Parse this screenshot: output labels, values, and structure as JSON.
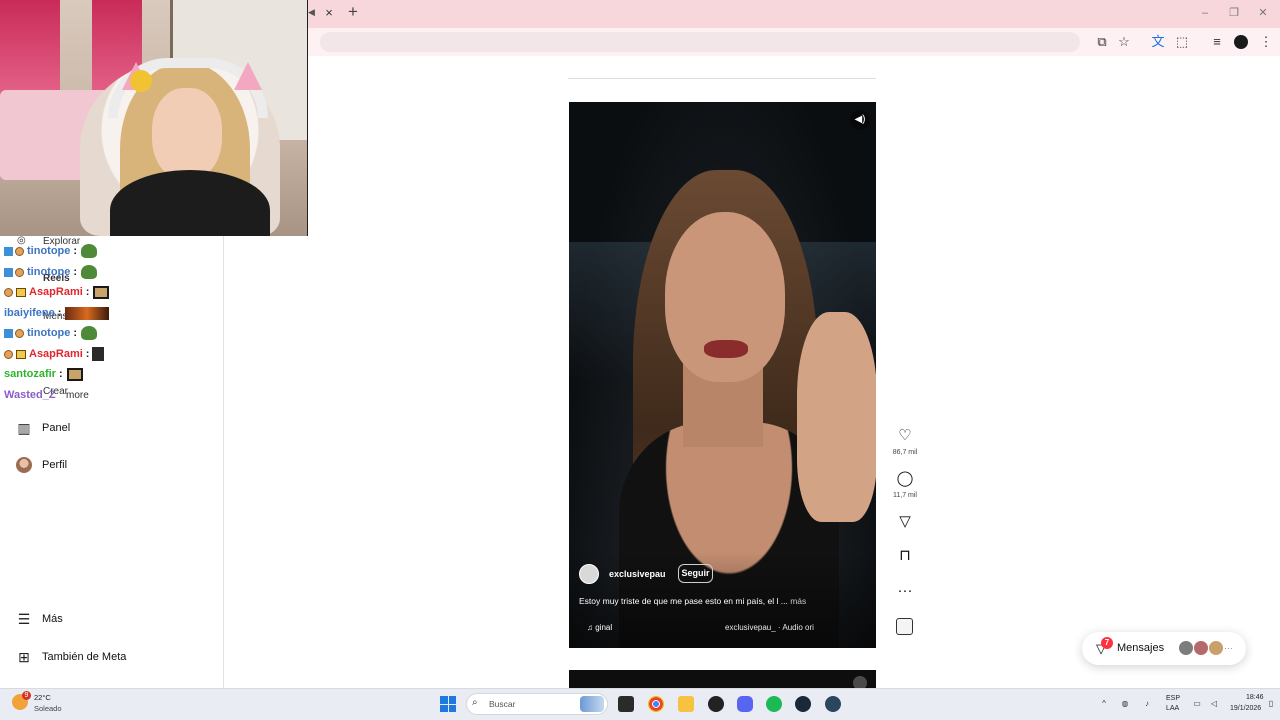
{
  "browser": {
    "tab_close": "×",
    "new_tab": "+"
  },
  "sidebar": {
    "items": [
      {
        "label": "Panel",
        "icon": "chart-icon"
      },
      {
        "label": "Perfil",
        "icon": "avatar"
      },
      {
        "label": "Más",
        "icon": "menu-icon"
      },
      {
        "label": "También de Meta",
        "icon": "grid-icon"
      }
    ],
    "ghost_items": [
      "Explorar",
      "Reels",
      "Mensa",
      "Crear",
      "more"
    ]
  },
  "chat": {
    "messages": [
      {
        "user": "tinotope",
        "sep": ":",
        "color": "#3d74c2",
        "emote": "pepe"
      },
      {
        "user": "tinotope",
        "sep": ":",
        "color": "#3d74c2",
        "emote": "pepe"
      },
      {
        "user": "AsapRami",
        "sep": ":",
        "color": "#e0262e",
        "emote": "glasses"
      },
      {
        "user": "ibaiyifene",
        "sep": ":",
        "color": "#3d74c2",
        "emote": "wide"
      },
      {
        "user": "tinotope",
        "sep": ":",
        "color": "#3d74c2",
        "emote": "pepe"
      },
      {
        "user": "AsapRami",
        "sep": ":",
        "color": "#e0262e",
        "emote": "small"
      },
      {
        "user": "santozafir",
        "sep": ":",
        "color": "#2bb52b",
        "emote": "glasses"
      },
      {
        "user": "Wasted_Z",
        "sep": ":",
        "color": "#8b5ec7",
        "emote": ""
      }
    ]
  },
  "reel": {
    "username": "exclusivepau",
    "follow_label": "Seguir",
    "caption": "Estoy muy triste de que me pase esto en mi país, el l ...",
    "more_label": "más",
    "audio_left": "♫ ginal",
    "audio_right": "exclusivepau_ · Audio ori"
  },
  "actions": {
    "likes": "86,7 mil",
    "comments": "11,7 mil"
  },
  "messages_pill": {
    "label": "Mensajes",
    "badge": "7"
  },
  "taskbar": {
    "weather_temp": "22°C",
    "weather_desc": "Soleado",
    "weather_badge": "9",
    "search_placeholder": "Buscar",
    "lang_top": "ESP",
    "lang_bottom": "LAA",
    "time": "18:46",
    "date": "19/1/2026"
  },
  "colors": {
    "tab_bar": "#f8d7dc",
    "toolbar": "#fdf1f3",
    "taskbar": "#e9edf3",
    "badge_red": "#ff3040"
  }
}
